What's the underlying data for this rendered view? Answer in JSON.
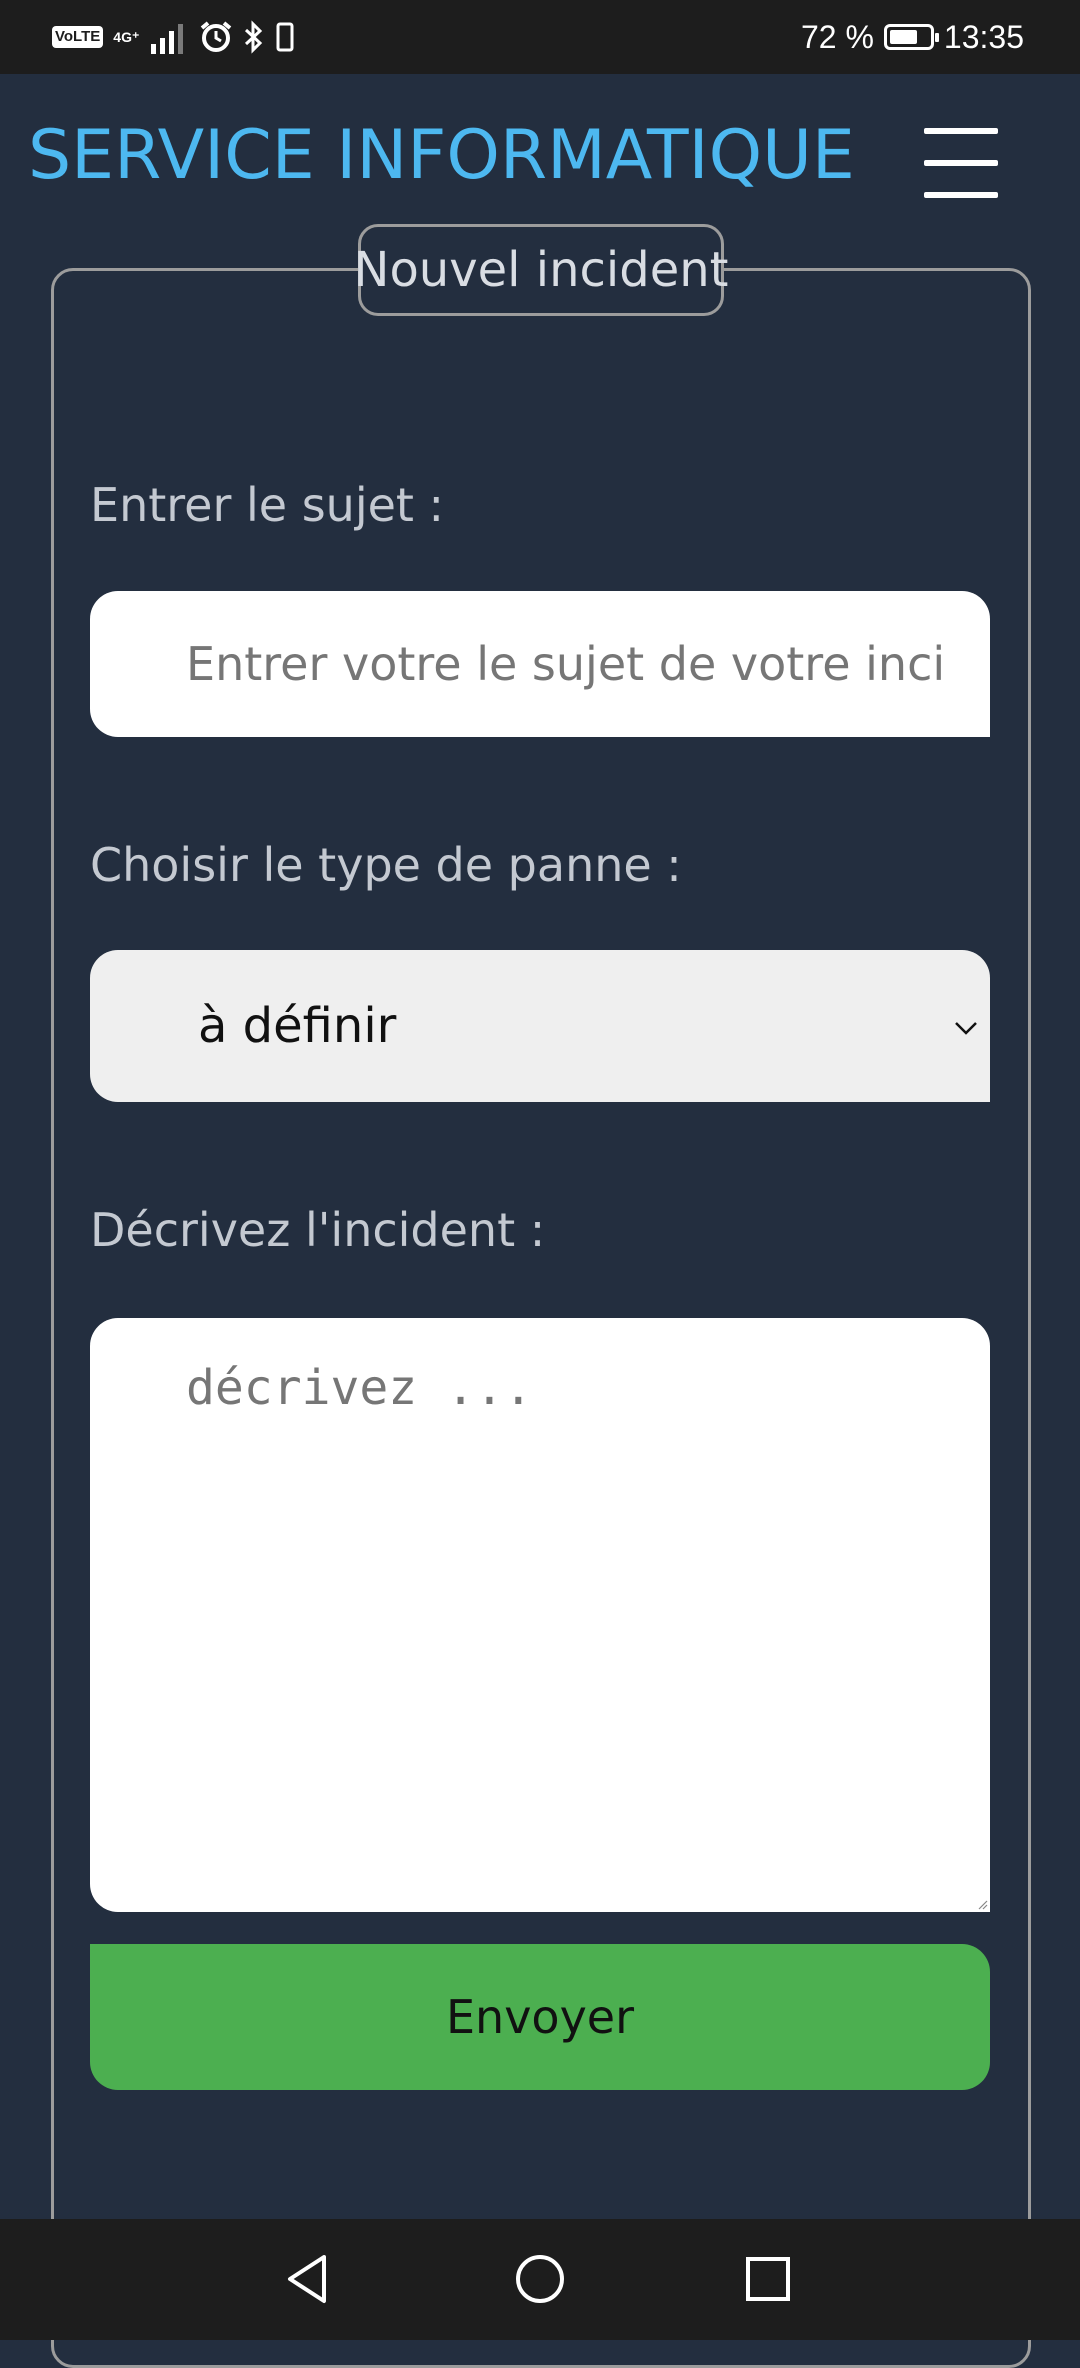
{
  "status_bar": {
    "volte": "VoLTE",
    "network": "4G⁺",
    "battery_percent": "72 %",
    "battery_level": 0.72,
    "time": "13:35"
  },
  "header": {
    "title": "SERVICE INFORMATIQUE",
    "menu_icon": "hamburger-menu-icon",
    "title_color": "#4db8f0"
  },
  "form": {
    "legend": "Nouvel incident",
    "subject_label": "Entrer le sujet :",
    "subject_placeholder": "Entrer votre le sujet de votre inci",
    "type_label": "Choisir le type de panne :",
    "type_selected": "à définir",
    "description_label": "Décrivez l'incident :",
    "description_placeholder": "décrivez ...",
    "submit_label": "Envoyer",
    "submit_color": "#4caf50"
  },
  "nav_bar": {
    "back_icon": "back-triangle-icon",
    "home_icon": "home-circle-icon",
    "recents_icon": "recents-square-icon"
  }
}
